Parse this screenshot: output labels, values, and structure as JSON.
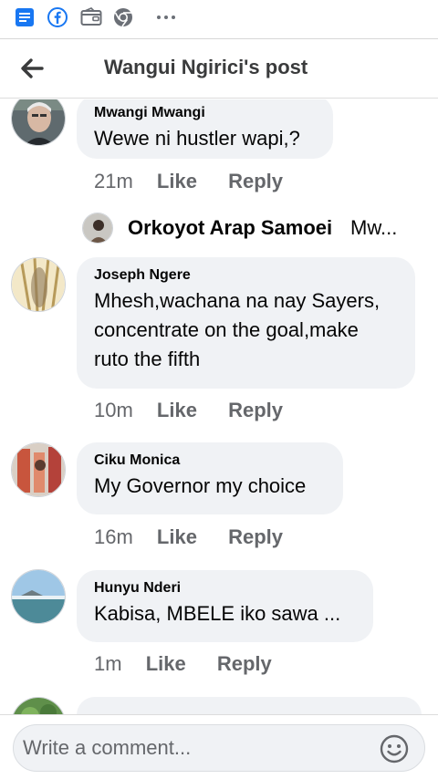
{
  "statusbar": {
    "icons": [
      "document-list-icon",
      "facebook-icon",
      "wallet-icon",
      "chrome-icon",
      "more-dots-icon"
    ],
    "colors": {
      "facebook_blue": "#1877f2",
      "grey_icon": "#6b6f76"
    }
  },
  "header": {
    "title": "Wangui Ngirici's post",
    "back_icon": "back-arrow-icon"
  },
  "comments": [
    {
      "author": "Mwangi Mwangi",
      "text": "Wewe ni hustler wapi,?",
      "time": "21m",
      "like_label": "Like",
      "reply_label": "Reply"
    },
    {
      "author": "Joseph Ngere",
      "text": "Mhesh,wachana na nay Sayers, concentrate on the goal,make ruto the fifth",
      "time": "10m",
      "like_label": "Like",
      "reply_label": "Reply"
    },
    {
      "author": "Ciku Monica",
      "text": "My Governor my choice",
      "time": "16m",
      "like_label": "Like",
      "reply_label": "Reply"
    },
    {
      "author": "Hunyu Nderi",
      "text": "Kabisa, MBELE iko sawa ...",
      "time": "1m",
      "like_label": "Like",
      "reply_label": "Reply"
    }
  ],
  "reply_preview": {
    "author": "Orkoyot Arap Samoei",
    "snippet": "Mw..."
  },
  "composer": {
    "placeholder": "Write a comment...",
    "emoji_icon": "smiley-icon"
  }
}
